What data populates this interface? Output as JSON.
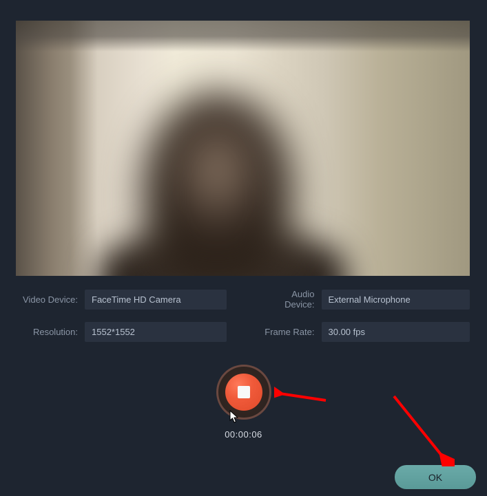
{
  "settings": {
    "videoDevice": {
      "label": "Video Device:",
      "value": "FaceTime HD Camera"
    },
    "audioDevice": {
      "label": "Audio Device:",
      "value": "External Microphone"
    },
    "resolution": {
      "label": "Resolution:",
      "value": "1552*1552"
    },
    "frameRate": {
      "label": "Frame Rate:",
      "value": "30.00 fps"
    }
  },
  "recorder": {
    "elapsed": "00:00:06"
  },
  "buttons": {
    "ok": "OK"
  }
}
